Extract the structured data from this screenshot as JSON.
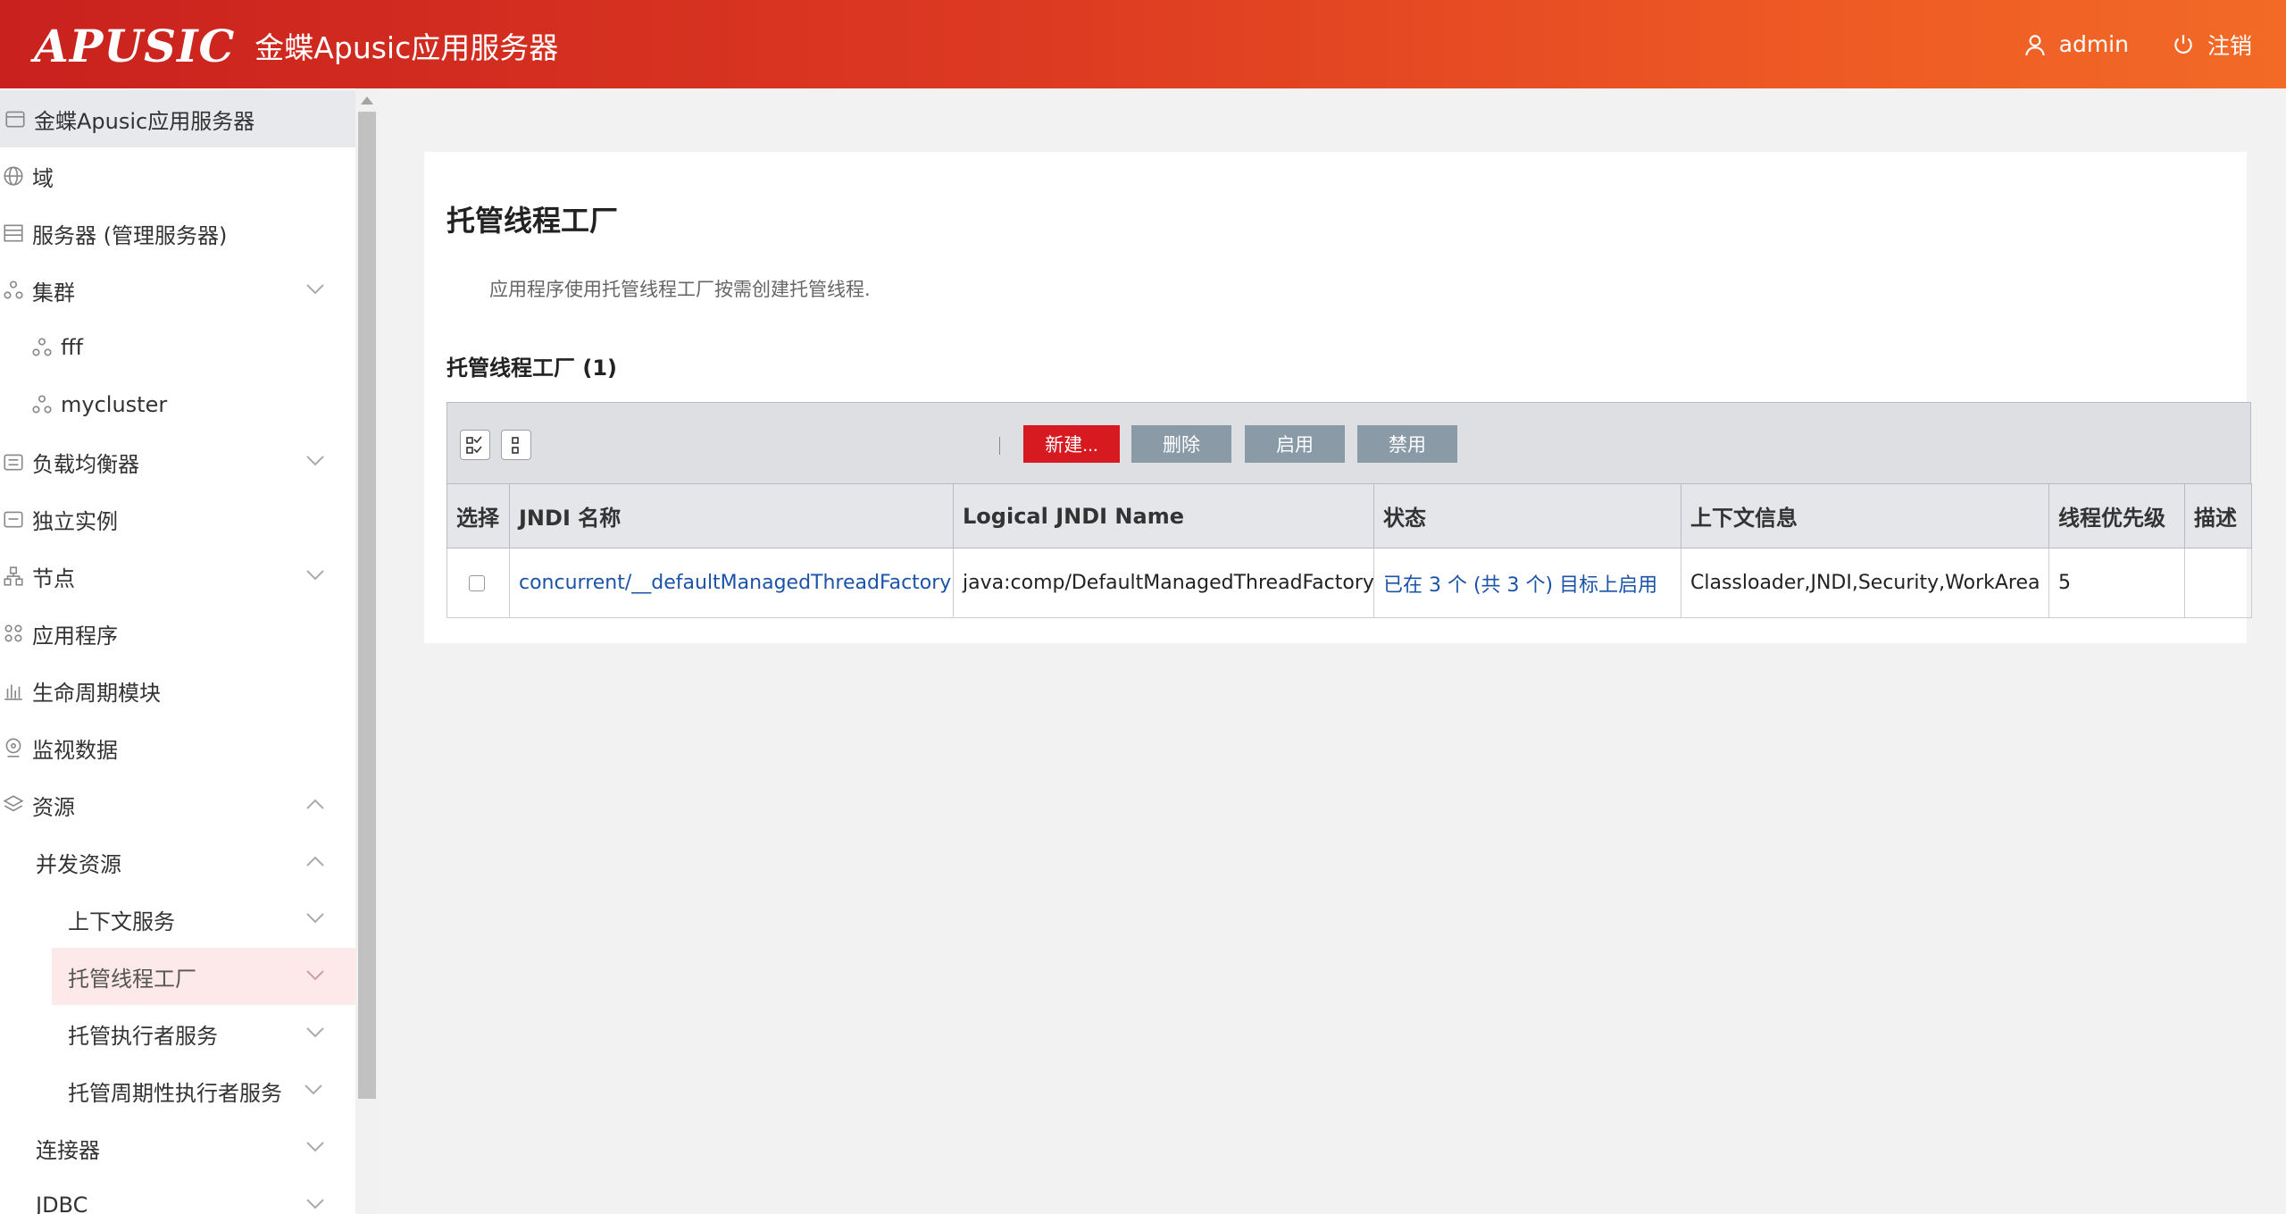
{
  "header": {
    "logo_mark": "APUSIC",
    "app_title": "金蝶Apusic应用服务器",
    "user_name": "admin",
    "logout_label": "注销"
  },
  "sidebar": {
    "items": [
      {
        "label": "金蝶Apusic应用服务器",
        "icon": "server-root-icon"
      },
      {
        "label": "域",
        "icon": "globe-icon"
      },
      {
        "label": "服务器 (管理服务器)",
        "icon": "server-icon"
      },
      {
        "label": "集群",
        "icon": "cluster-icon"
      },
      {
        "label": "fff",
        "icon": "cluster-icon"
      },
      {
        "label": "mycluster",
        "icon": "cluster-icon"
      },
      {
        "label": "负载均衡器",
        "icon": "load-balancer-icon"
      },
      {
        "label": "独立实例",
        "icon": "instance-icon"
      },
      {
        "label": "节点",
        "icon": "node-icon"
      },
      {
        "label": "应用程序",
        "icon": "apps-icon"
      },
      {
        "label": "生命周期模块",
        "icon": "chart-icon"
      },
      {
        "label": "监视数据",
        "icon": "monitor-icon"
      },
      {
        "label": "资源",
        "icon": "layers-icon"
      },
      {
        "label": "并发资源",
        "icon": ""
      },
      {
        "label": "上下文服务",
        "icon": ""
      },
      {
        "label": "托管线程工厂",
        "icon": ""
      },
      {
        "label": "托管执行者服务",
        "icon": ""
      },
      {
        "label": "托管周期性执行者服务",
        "icon": ""
      },
      {
        "label": "连接器",
        "icon": ""
      },
      {
        "label": "JDBC",
        "icon": ""
      }
    ]
  },
  "main": {
    "title": "托管线程工厂",
    "description": "应用程序使用托管线程工厂按需创建托管线程.",
    "table_caption": "托管线程工厂 (1)",
    "toolbar": {
      "new_label": "新建...",
      "delete_label": "删除",
      "enable_label": "启用",
      "disable_label": "禁用"
    },
    "columns": [
      "选择",
      "JNDI 名称",
      "Logical JNDI Name",
      "状态",
      "上下文信息",
      "线程优先级",
      "描述"
    ],
    "rows": [
      {
        "jndi_name": "concurrent/__defaultManagedThreadFactory",
        "logical_jndi_name": "java:comp/DefaultManagedThreadFactory",
        "status": "已在 3 个 (共 3 个) 目标上启用",
        "context_info": "Classloader,JNDI,Security,WorkArea",
        "thread_priority": "5",
        "description": ""
      }
    ]
  },
  "colors": {
    "header_start": "#c9211e",
    "header_end": "#f26a26",
    "primary_button": "#d71a20",
    "secondary_button": "#8a9aa7",
    "link": "#1a53a8",
    "active_nav_bg": "#fde9ea"
  }
}
